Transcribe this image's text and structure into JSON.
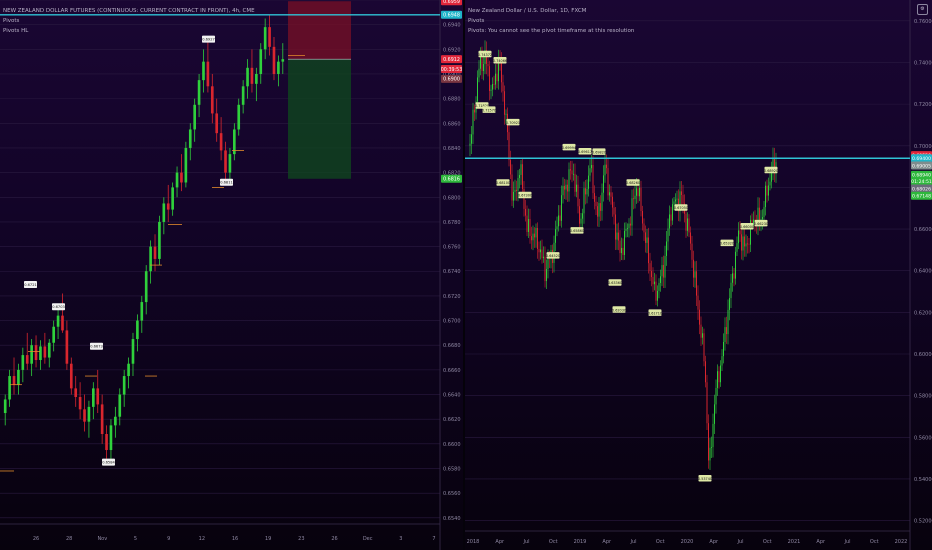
{
  "chart_data": [
    {
      "type": "candlestick",
      "symbol_title": "NEW ZEALAND DOLLAR FUTURES (CONTINUOUS: CURRENT CONTRACT IN FRONT), 4h, CME",
      "indicator_1": "Pivots",
      "indicator_2": "Pivots HL",
      "x_ticks": [
        "26",
        "28",
        "Nov",
        "5",
        "9",
        "12",
        "16",
        "19",
        "23",
        "26",
        "Dec",
        "3",
        "7"
      ],
      "y_ticks": [
        "0.6960",
        "0.6940",
        "0.6920",
        "0.6900",
        "0.6880",
        "0.6860",
        "0.6840",
        "0.6820",
        "0.6800",
        "0.6780",
        "0.6760",
        "0.6740",
        "0.6720",
        "0.6700",
        "0.6680",
        "0.6660",
        "0.6640",
        "0.6620",
        "0.6600",
        "0.6580",
        "0.6560",
        "0.6540"
      ],
      "ylim": [
        0.6535,
        0.696
      ],
      "price_labels": [
        {
          "text": "0.6959",
          "color": "#e0263a",
          "value": 0.6959
        },
        {
          "text": "0.6948",
          "color": "#1fb5c9",
          "value": 0.6948
        },
        {
          "text": "0.6912",
          "color": "#e0263a",
          "value": 0.6912
        },
        {
          "text": "00:39:53",
          "color": "#e0263a",
          "value": 0.6904
        },
        {
          "text": "0.6900",
          "color": "#7a3540",
          "value": 0.6896
        },
        {
          "text": "0.6816",
          "color": "#2eb83c",
          "value": 0.6815
        }
      ],
      "horizontal_line": {
        "value": 0.6948,
        "color": "#2fc3d6"
      },
      "position_box": {
        "entry": 0.6912,
        "stop": 0.6959,
        "target": 0.6815
      },
      "pivot_labels": [
        {
          "text": "0.6721",
          "value": 0.6728
        },
        {
          "text": "0.6703",
          "value": 0.671
        },
        {
          "text": "0.6673",
          "value": 0.6678
        },
        {
          "text": "0.6584",
          "value": 0.6584
        },
        {
          "text": "0.6927",
          "value": 0.6927
        },
        {
          "text": "0.6811",
          "value": 0.6811
        }
      ],
      "candles": [
        {
          "o": 0.6625,
          "h": 0.664,
          "l": 0.6615,
          "c": 0.6636
        },
        {
          "o": 0.6636,
          "h": 0.666,
          "l": 0.663,
          "c": 0.6655
        },
        {
          "o": 0.6655,
          "h": 0.667,
          "l": 0.664,
          "c": 0.6648
        },
        {
          "o": 0.6648,
          "h": 0.6665,
          "l": 0.664,
          "c": 0.666
        },
        {
          "o": 0.666,
          "h": 0.6678,
          "l": 0.665,
          "c": 0.6672
        },
        {
          "o": 0.6672,
          "h": 0.669,
          "l": 0.666,
          "c": 0.6665
        },
        {
          "o": 0.6665,
          "h": 0.6685,
          "l": 0.6655,
          "c": 0.668
        },
        {
          "o": 0.668,
          "h": 0.6688,
          "l": 0.6662,
          "c": 0.6668
        },
        {
          "o": 0.6668,
          "h": 0.6684,
          "l": 0.666,
          "c": 0.6679
        },
        {
          "o": 0.6679,
          "h": 0.669,
          "l": 0.6665,
          "c": 0.667
        },
        {
          "o": 0.667,
          "h": 0.6685,
          "l": 0.6662,
          "c": 0.6682
        },
        {
          "o": 0.6682,
          "h": 0.67,
          "l": 0.6675,
          "c": 0.6695
        },
        {
          "o": 0.6695,
          "h": 0.6712,
          "l": 0.6685,
          "c": 0.6704
        },
        {
          "o": 0.6704,
          "h": 0.6722,
          "l": 0.669,
          "c": 0.6692
        },
        {
          "o": 0.6692,
          "h": 0.67,
          "l": 0.666,
          "c": 0.6665
        },
        {
          "o": 0.6665,
          "h": 0.667,
          "l": 0.664,
          "c": 0.6645
        },
        {
          "o": 0.6645,
          "h": 0.6655,
          "l": 0.663,
          "c": 0.6638
        },
        {
          "o": 0.6638,
          "h": 0.665,
          "l": 0.662,
          "c": 0.6628
        },
        {
          "o": 0.6628,
          "h": 0.664,
          "l": 0.661,
          "c": 0.6618
        },
        {
          "o": 0.6618,
          "h": 0.6635,
          "l": 0.6605,
          "c": 0.663
        },
        {
          "o": 0.663,
          "h": 0.665,
          "l": 0.662,
          "c": 0.6645
        },
        {
          "o": 0.6645,
          "h": 0.666,
          "l": 0.6625,
          "c": 0.6632
        },
        {
          "o": 0.6632,
          "h": 0.664,
          "l": 0.66,
          "c": 0.6608
        },
        {
          "o": 0.6608,
          "h": 0.6615,
          "l": 0.6588,
          "c": 0.6595
        },
        {
          "o": 0.6595,
          "h": 0.662,
          "l": 0.6585,
          "c": 0.6615
        },
        {
          "o": 0.6615,
          "h": 0.663,
          "l": 0.6605,
          "c": 0.6622
        },
        {
          "o": 0.6622,
          "h": 0.6645,
          "l": 0.6615,
          "c": 0.664
        },
        {
          "o": 0.664,
          "h": 0.666,
          "l": 0.663,
          "c": 0.6655
        },
        {
          "o": 0.6655,
          "h": 0.667,
          "l": 0.6645,
          "c": 0.6665
        },
        {
          "o": 0.6665,
          "h": 0.669,
          "l": 0.6655,
          "c": 0.6685
        },
        {
          "o": 0.6685,
          "h": 0.6705,
          "l": 0.6675,
          "c": 0.67
        },
        {
          "o": 0.67,
          "h": 0.672,
          "l": 0.669,
          "c": 0.6715
        },
        {
          "o": 0.6715,
          "h": 0.6745,
          "l": 0.6705,
          "c": 0.674
        },
        {
          "o": 0.674,
          "h": 0.6765,
          "l": 0.673,
          "c": 0.676
        },
        {
          "o": 0.676,
          "h": 0.677,
          "l": 0.674,
          "c": 0.675
        },
        {
          "o": 0.675,
          "h": 0.6785,
          "l": 0.6745,
          "c": 0.678
        },
        {
          "o": 0.678,
          "h": 0.68,
          "l": 0.677,
          "c": 0.6795
        },
        {
          "o": 0.6795,
          "h": 0.681,
          "l": 0.678,
          "c": 0.679
        },
        {
          "o": 0.679,
          "h": 0.6812,
          "l": 0.6785,
          "c": 0.6808
        },
        {
          "o": 0.6808,
          "h": 0.6825,
          "l": 0.68,
          "c": 0.682
        },
        {
          "o": 0.682,
          "h": 0.6835,
          "l": 0.6805,
          "c": 0.6812
        },
        {
          "o": 0.6812,
          "h": 0.6845,
          "l": 0.6808,
          "c": 0.684
        },
        {
          "o": 0.684,
          "h": 0.686,
          "l": 0.683,
          "c": 0.6855
        },
        {
          "o": 0.6855,
          "h": 0.688,
          "l": 0.6845,
          "c": 0.6875
        },
        {
          "o": 0.6875,
          "h": 0.69,
          "l": 0.6865,
          "c": 0.6895
        },
        {
          "o": 0.6895,
          "h": 0.692,
          "l": 0.6885,
          "c": 0.691
        },
        {
          "o": 0.691,
          "h": 0.6927,
          "l": 0.6885,
          "c": 0.689
        },
        {
          "o": 0.689,
          "h": 0.69,
          "l": 0.686,
          "c": 0.6868
        },
        {
          "o": 0.6868,
          "h": 0.688,
          "l": 0.6845,
          "c": 0.6852
        },
        {
          "o": 0.6852,
          "h": 0.6865,
          "l": 0.683,
          "c": 0.6838
        },
        {
          "o": 0.6838,
          "h": 0.6845,
          "l": 0.6812,
          "c": 0.682
        },
        {
          "o": 0.682,
          "h": 0.684,
          "l": 0.6811,
          "c": 0.6835
        },
        {
          "o": 0.6835,
          "h": 0.686,
          "l": 0.683,
          "c": 0.6855
        },
        {
          "o": 0.6855,
          "h": 0.688,
          "l": 0.685,
          "c": 0.6875
        },
        {
          "o": 0.6875,
          "h": 0.6895,
          "l": 0.6868,
          "c": 0.689
        },
        {
          "o": 0.689,
          "h": 0.6912,
          "l": 0.688,
          "c": 0.6905
        },
        {
          "o": 0.6905,
          "h": 0.692,
          "l": 0.6885,
          "c": 0.6892
        },
        {
          "o": 0.6892,
          "h": 0.6905,
          "l": 0.6878,
          "c": 0.69
        },
        {
          "o": 0.69,
          "h": 0.6925,
          "l": 0.6892,
          "c": 0.692
        },
        {
          "o": 0.692,
          "h": 0.6945,
          "l": 0.6912,
          "c": 0.6938
        },
        {
          "o": 0.6938,
          "h": 0.6948,
          "l": 0.6915,
          "c": 0.6922
        },
        {
          "o": 0.6922,
          "h": 0.693,
          "l": 0.6895,
          "c": 0.69
        },
        {
          "o": 0.69,
          "h": 0.6915,
          "l": 0.689,
          "c": 0.691
        },
        {
          "o": 0.691,
          "h": 0.6925,
          "l": 0.69,
          "c": 0.6912
        }
      ]
    },
    {
      "type": "candlestick",
      "symbol_title": "New Zealand Dollar / U.S. Dollar, 1D, FXCM",
      "indicator_1": "Pivots",
      "indicator_2": "Pivots: You cannot see the pivot timeframe at this resolution",
      "x_ticks": [
        "2018",
        "Apr",
        "Jul",
        "Oct",
        "2019",
        "Apr",
        "Jul",
        "Oct",
        "2020",
        "Apr",
        "Jul",
        "Oct",
        "2021",
        "Apr",
        "Jul",
        "Oct",
        "2022"
      ],
      "y_ticks": [
        "0.76000",
        "0.74000",
        "0.72000",
        "0.70000",
        "0.68000",
        "0.66000",
        "0.64000",
        "0.62000",
        "0.60000",
        "0.58000",
        "0.56000",
        "0.54000",
        "0.52000"
      ],
      "ylim": [
        0.515,
        0.77
      ],
      "price_labels": [
        {
          "text": "0.69550",
          "color": "#e0263a",
          "value": 0.6955
        },
        {
          "text": "0.69400",
          "color": "#1fb5c9",
          "value": 0.694
        },
        {
          "text": "0.69005",
          "color": "#7f8c8d",
          "value": 0.6905
        },
        {
          "text": "0.68940",
          "color": "#2eb83c",
          "value": 0.686
        },
        {
          "text": "01:24:51",
          "color": "#2eb83c",
          "value": 0.683
        },
        {
          "text": "0.68026",
          "color": "#6a6a7a",
          "value": 0.6795
        },
        {
          "text": "0.67148",
          "color": "#2eb83c",
          "value": 0.676
        }
      ],
      "horizontal_line": {
        "value": 0.694,
        "color": "#2fc3d6"
      },
      "pivot_labels": [
        {
          "text": "0.74372",
          "value": 0.7437
        },
        {
          "text": "0.74066",
          "value": 0.7407
        },
        {
          "text": "0.71820",
          "value": 0.719
        },
        {
          "text": "0.71570",
          "value": 0.717
        },
        {
          "text": "0.70921",
          "value": 0.711
        },
        {
          "text": "0.68100",
          "value": 0.682
        },
        {
          "text": "0.67300",
          "value": 0.676
        },
        {
          "text": "0.69994",
          "value": 0.699
        },
        {
          "text": "0.69617",
          "value": 0.697
        },
        {
          "text": "0.69820",
          "value": 0.6968
        },
        {
          "text": "0.64520",
          "value": 0.647
        },
        {
          "text": "0.65860",
          "value": 0.659
        },
        {
          "text": "0.63360",
          "value": 0.634
        },
        {
          "text": "0.68260",
          "value": 0.682
        },
        {
          "text": "0.62030",
          "value": 0.621
        },
        {
          "text": "0.67050",
          "value": 0.67
        },
        {
          "text": "0.61710",
          "value": 0.6195
        },
        {
          "text": "0.65320",
          "value": 0.653
        },
        {
          "text": "0.66000",
          "value": 0.661
        },
        {
          "text": "0.66230",
          "value": 0.6625
        },
        {
          "text": "0.68920",
          "value": 0.688
        },
        {
          "text": "0.53740",
          "value": 0.54
        }
      ]
    }
  ]
}
